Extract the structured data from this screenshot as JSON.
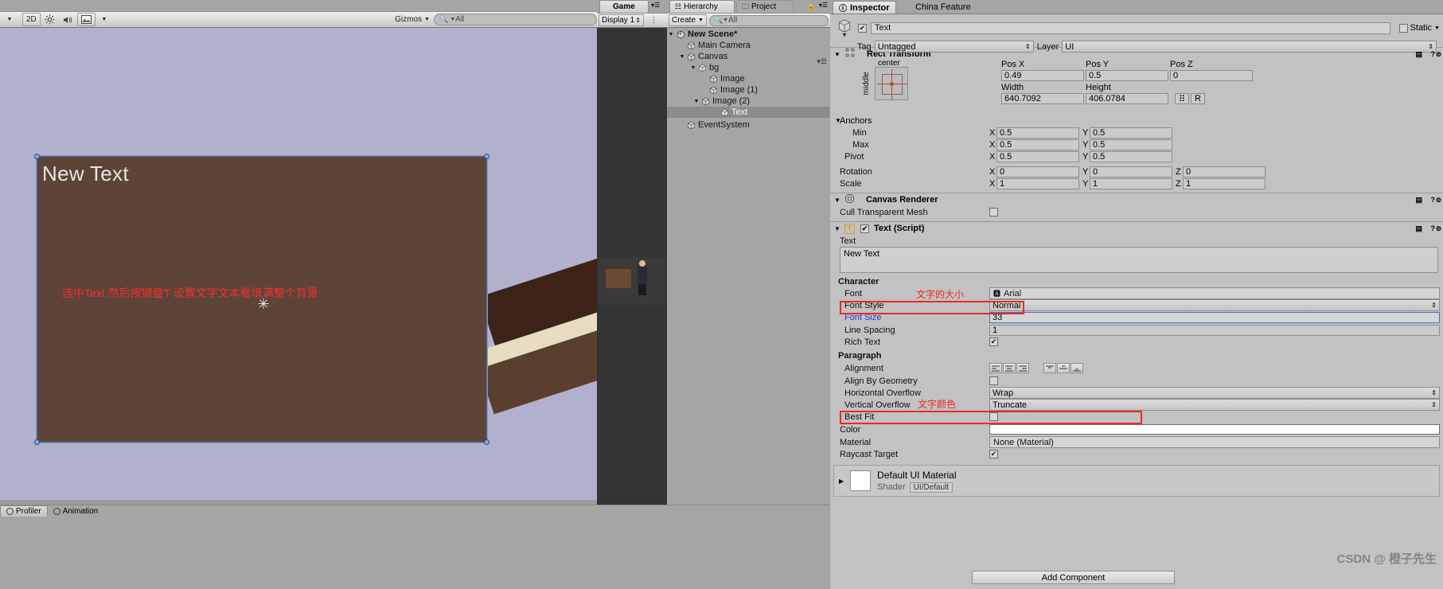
{
  "scene_view": {
    "toolbar": {
      "mode_2d": "2D",
      "lighting_icon": "sun-icon",
      "audio_icon": "speaker-icon",
      "fx_icon": "image-icon",
      "gizmos_label": "Gizmos",
      "search_placeholder": "All",
      "search_icon": "search-icon"
    },
    "text_object_label": "New Text",
    "annotation": "选中Text  然后按键盘T  设置文字文本框填满整个背景"
  },
  "game_panel": {
    "tab_label": "Game",
    "display_dropdown": "Display 1"
  },
  "hierarchy": {
    "tabs": [
      {
        "label": "Hierarchy",
        "active": true
      },
      {
        "label": "Project",
        "active": false
      }
    ],
    "create_label": "Create",
    "search_placeholder": "All",
    "tree": [
      {
        "label": "New Scene*",
        "depth": 0,
        "arrow": "down",
        "icon": "unity-scene-icon",
        "selected": false,
        "bold": true
      },
      {
        "label": "Main Camera",
        "depth": 1,
        "arrow": "none",
        "icon": "gameobject-cube-icon",
        "selected": false
      },
      {
        "label": "Canvas",
        "depth": 1,
        "arrow": "down",
        "icon": "gameobject-cube-icon",
        "selected": false
      },
      {
        "label": "bg",
        "depth": 2,
        "arrow": "down",
        "icon": "gameobject-cube-icon",
        "selected": false
      },
      {
        "label": "Image",
        "depth": 3,
        "arrow": "none",
        "icon": "gameobject-cube-icon",
        "selected": false
      },
      {
        "label": "Image (1)",
        "depth": 3,
        "arrow": "none",
        "icon": "gameobject-cube-icon",
        "selected": false
      },
      {
        "label": "Image (2)",
        "depth": 3,
        "arrow": "down",
        "icon": "gameobject-cube-icon",
        "selected": false
      },
      {
        "label": "Text",
        "depth": 4,
        "arrow": "none",
        "icon": "gameobject-cube-icon",
        "selected": true
      },
      {
        "label": "EventSystem",
        "depth": 1,
        "arrow": "none",
        "icon": "gameobject-cube-icon",
        "selected": false
      }
    ]
  },
  "inspector": {
    "tabs": [
      {
        "label": "Inspector",
        "active": true
      },
      {
        "label": "China Feature",
        "active": false
      }
    ],
    "object": {
      "enabled": true,
      "name": "Text",
      "static_label": "Static",
      "static_checked": false,
      "tag_label": "Tag",
      "tag_value": "Untagged",
      "layer_label": "Layer",
      "layer_value": "UI"
    },
    "rect_transform": {
      "title": "Rect Transform",
      "anchor_preset_h": "center",
      "anchor_preset_v": "middle",
      "pos_x_label": "Pos X",
      "pos_x": "0.49",
      "pos_y_label": "Pos Y",
      "pos_y": "0.5",
      "pos_z_label": "Pos Z",
      "pos_z": "0",
      "width_label": "Width",
      "width": "640.7092",
      "height_label": "Height",
      "height": "406.0784",
      "blueprint_btn": "blueprint-icon",
      "raw_btn": "R",
      "anchors_label": "Anchors",
      "min_label": "Min",
      "min_x": "0.5",
      "min_y": "0.5",
      "max_label": "Max",
      "max_x": "0.5",
      "max_y": "0.5",
      "pivot_label": "Pivot",
      "pivot_x": "0.5",
      "pivot_y": "0.5",
      "rotation_label": "Rotation",
      "rot_x": "0",
      "rot_y": "0",
      "rot_z": "0",
      "scale_label": "Scale",
      "scale_x": "1",
      "scale_y": "1",
      "scale_z": "1"
    },
    "canvas_renderer": {
      "title": "Canvas Renderer",
      "cull_label": "Cull Transparent Mesh",
      "cull_checked": false
    },
    "text_script": {
      "title": "Text (Script)",
      "enabled": true,
      "script_icon": "T",
      "text_label": "Text",
      "text_value": "New Text",
      "character_label": "Character",
      "font_label": "Font",
      "font_value": "Arial",
      "font_style_label": "Font Style",
      "font_style_value": "Normal",
      "font_size_label": "Font Size",
      "font_size_value": "33",
      "line_spacing_label": "Line Spacing",
      "line_spacing_value": "1",
      "rich_text_label": "Rich Text",
      "rich_text_checked": true,
      "paragraph_label": "Paragraph",
      "alignment_label": "Alignment",
      "align_by_geometry_label": "Align By Geometry",
      "align_by_geometry_checked": false,
      "horizontal_overflow_label": "Horizontal Overflow",
      "horizontal_overflow_value": "Wrap",
      "vertical_overflow_label": "Vertical Overflow",
      "vertical_overflow_value": "Truncate",
      "best_fit_label": "Best Fit",
      "best_fit_checked": false,
      "color_label": "Color",
      "color_value": "#FFFFFF",
      "material_label": "Material",
      "material_value": "None (Material)",
      "raycast_target_label": "Raycast Target",
      "raycast_target_checked": true
    },
    "material_footer": {
      "name": "Default UI Material",
      "shader_label": "Shader",
      "shader_value": "UI/Default"
    },
    "add_component_label": "Add Component",
    "watermark": "CSDN @ 橙子先生"
  },
  "annotations": {
    "font_size_note": "文字的大小",
    "color_note": "文字颜色",
    "accent_red": "#ee2a22"
  },
  "statusbar": {
    "tabs": [
      {
        "label": "Profiler",
        "icon": "profiler-icon"
      },
      {
        "label": "Animation",
        "icon": "animation-icon"
      }
    ]
  }
}
